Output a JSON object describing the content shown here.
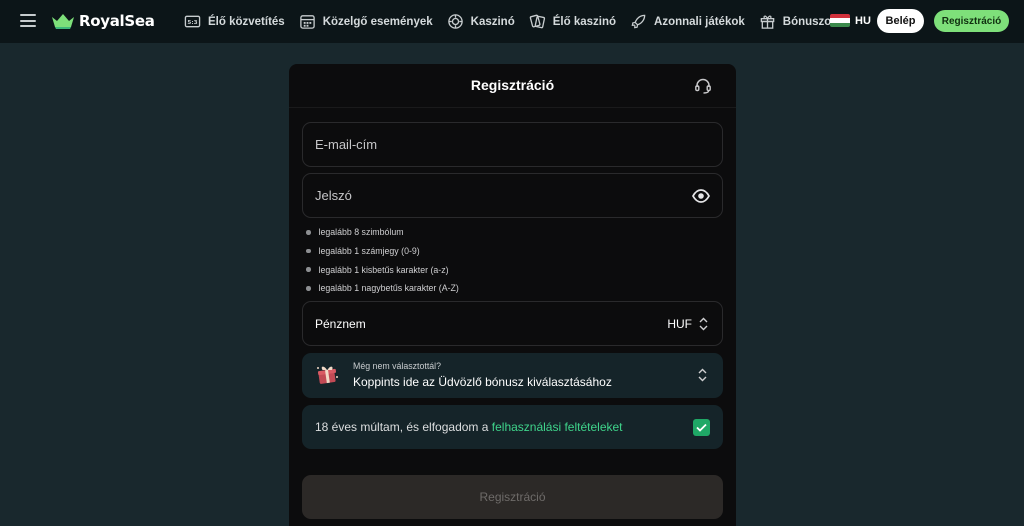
{
  "header": {
    "brand": "RoyalSea",
    "nav": [
      {
        "label": "Élő közvetítés",
        "icon": "scoreboard-icon"
      },
      {
        "label": "Közelgő események",
        "icon": "calendar-icon"
      },
      {
        "label": "Kaszinó",
        "icon": "casino-chip-icon"
      },
      {
        "label": "Élő kaszinó",
        "icon": "playing-cards-icon"
      },
      {
        "label": "Azonnali játékok",
        "icon": "rocket-icon"
      },
      {
        "label": "Bónuszok",
        "icon": "gift-icon"
      }
    ],
    "language": "HU",
    "login_label": "Belép",
    "register_label": "Regisztráció",
    "accent_color": "#7ee07a"
  },
  "modal": {
    "title": "Regisztráció",
    "email_placeholder": "E-mail-cím",
    "password_placeholder": "Jelszó",
    "password_rules": [
      "legalább 8 szimbólum",
      "legalább 1 számjegy (0-9)",
      "legalább 1 kisbetűs karakter (a-z)",
      "legalább 1 nagybetűs karakter (A-Z)"
    ],
    "currency": {
      "label": "Pénznem",
      "value": "HUF"
    },
    "bonus": {
      "hint": "Még nem választottál?",
      "label": "Koppints ide az Üdvözlő bónusz kiválasztásához"
    },
    "terms": {
      "text": "18 éves múltam, és elfogadom a ",
      "link": "felhasználási feltételeket",
      "checked": true
    },
    "submit_label": "Regisztráció",
    "link_color": "#3fd48b"
  }
}
